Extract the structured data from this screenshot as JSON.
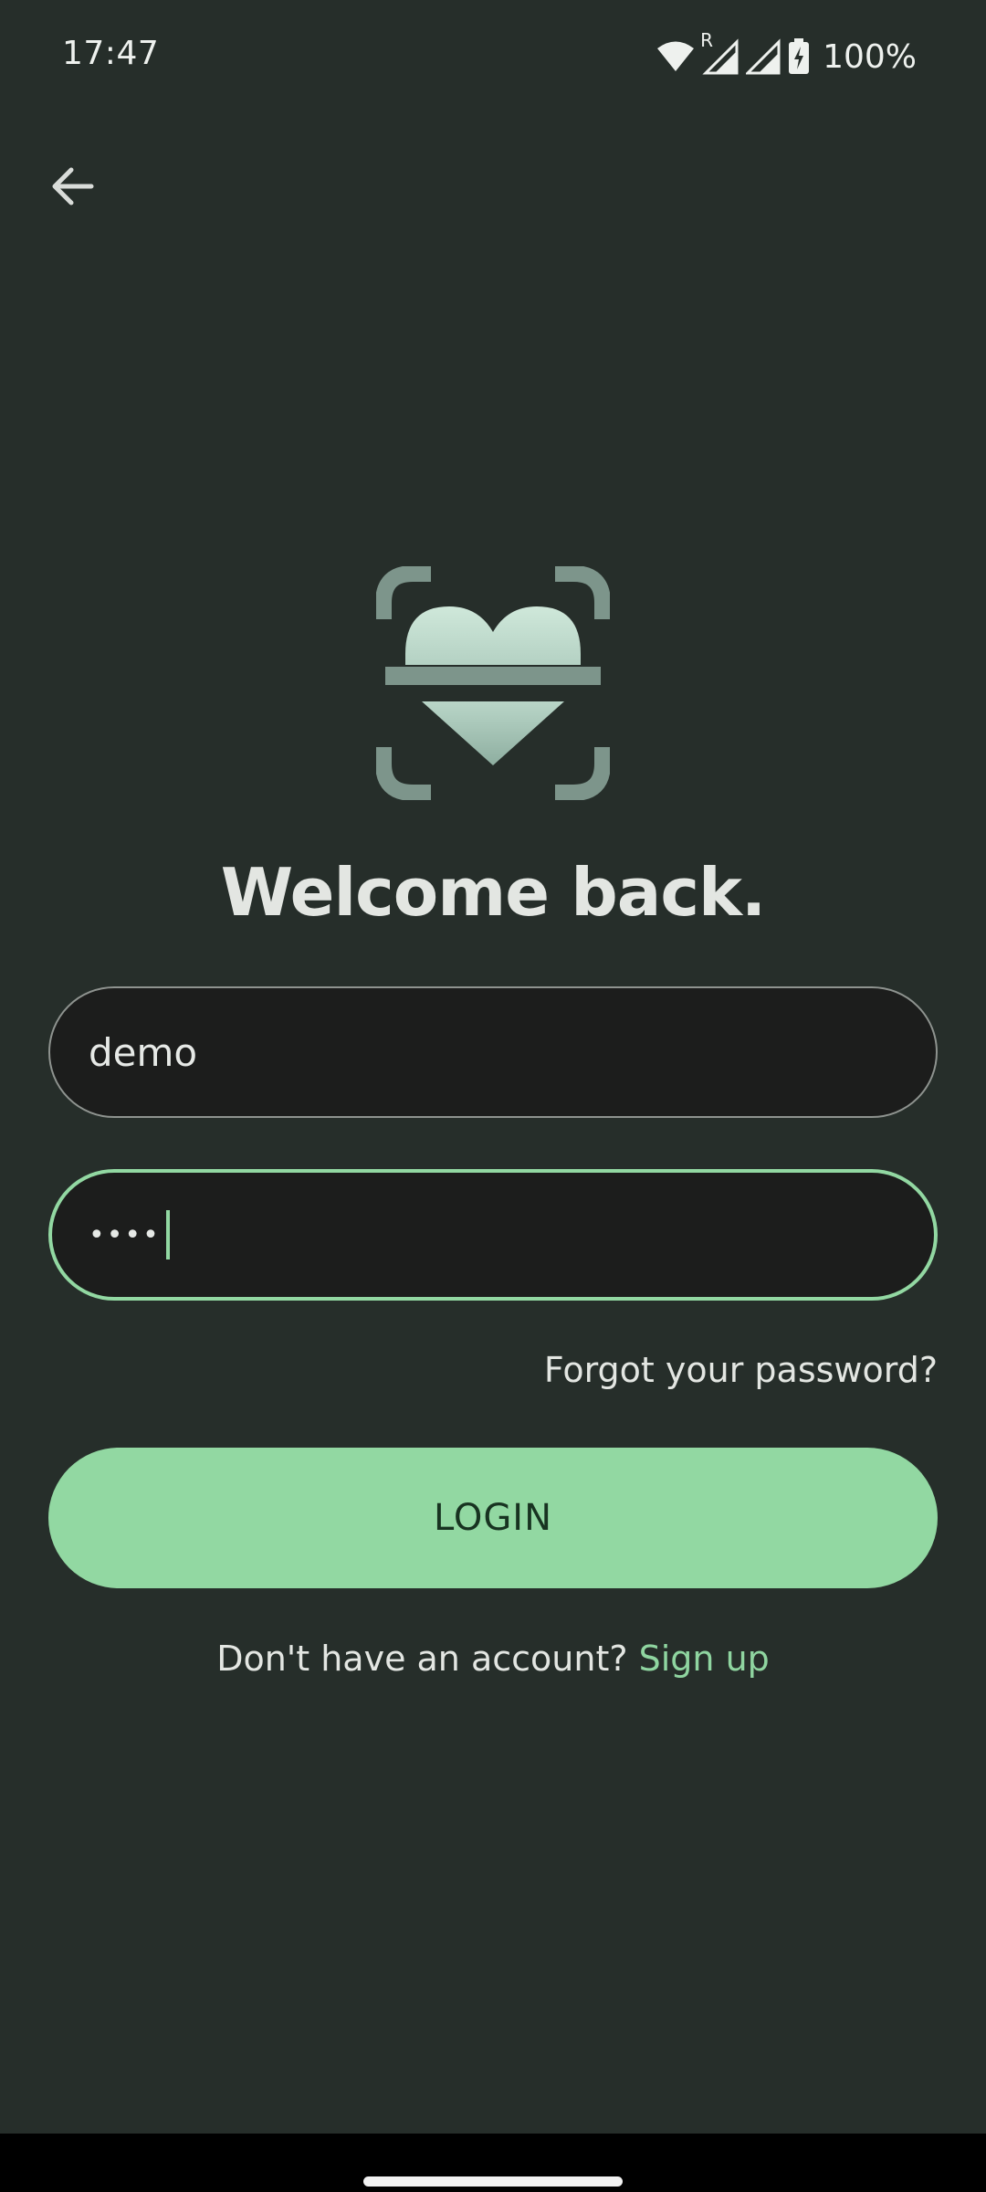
{
  "status_bar": {
    "time": "17:47",
    "battery_percent": "100%",
    "icons": [
      "wifi-icon",
      "signal-roaming-icon",
      "signal-icon",
      "battery-charging-icon"
    ],
    "roaming_label": "R"
  },
  "nav": {
    "back_icon": "arrow-left-icon"
  },
  "logo": {
    "icon": "heart-scan-logo"
  },
  "title": "Welcome back.",
  "username": {
    "value": "demo"
  },
  "password": {
    "masked_value": "••••"
  },
  "forgot_password_label": "Forgot your password?",
  "login_label": "LOGIN",
  "signup": {
    "prompt": "Don't have an account?",
    "link_label": "Sign up"
  },
  "colors": {
    "background": "#262e2a",
    "accent": "#92d8a2",
    "field_background": "#1c1d1c",
    "logo_light": "#c6e0d3",
    "logo_dark": "#7d958b"
  }
}
